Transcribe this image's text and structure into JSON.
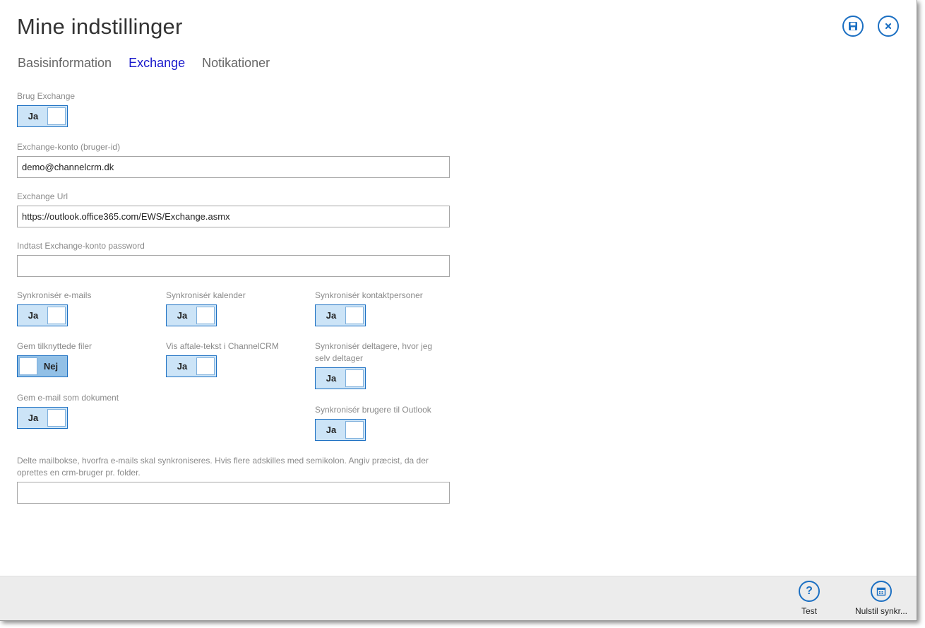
{
  "header": {
    "title": "Mine indstillinger",
    "save_icon": "save-icon",
    "close_icon": "close-icon"
  },
  "tabs": [
    {
      "label": "Basisinformation",
      "active": false
    },
    {
      "label": "Exchange",
      "active": true
    },
    {
      "label": "Notikationer",
      "active": false
    }
  ],
  "form": {
    "use_exchange": {
      "label": "Brug Exchange",
      "value": "Ja"
    },
    "account": {
      "label": "Exchange-konto (bruger-id)",
      "value": "demo@channelcrm.dk"
    },
    "url": {
      "label": "Exchange Url",
      "value": "https://outlook.office365.com/EWS/Exchange.asmx"
    },
    "password": {
      "label": "Indtast Exchange-konto password",
      "value": ""
    },
    "sync_emails": {
      "label": "Synkronisér e-mails",
      "value": "Ja"
    },
    "sync_calendar": {
      "label": "Synkronisér kalender",
      "value": "Ja"
    },
    "sync_contacts": {
      "label": "Synkronisér kontaktpersoner",
      "value": "Ja"
    },
    "save_attachments": {
      "label": "Gem tilknyttede filer",
      "value": "Nej"
    },
    "show_appointment_text": {
      "label": "Vis aftale-tekst i ChannelCRM",
      "value": "Ja"
    },
    "sync_participants": {
      "label_line1": "Synkronisér deltagere, hvor jeg",
      "label_line2": "selv deltager",
      "value": "Ja"
    },
    "save_email_doc": {
      "label": "Gem e-mail som dokument",
      "value": "Ja"
    },
    "sync_users_outlook": {
      "label": "Synkronisér brugere til Outlook",
      "value": "Ja"
    },
    "shared_mailboxes": {
      "label_line1": "Delte mailbokse, hvorfra e-mails skal synkroniseres. Hvis flere adskilles med semikolon. Angiv præcist, da der",
      "label_line2": "oprettes en crm-bruger pr. folder.",
      "value": ""
    }
  },
  "footer": {
    "test": {
      "label": "Test",
      "icon": "question-icon"
    },
    "reset": {
      "label": "Nulstil synkr...",
      "icon": "calendar-icon"
    }
  },
  "colors": {
    "accent": "#1b6fc2",
    "active_tab": "#1a1acc",
    "toggle_on": "#cce4f7",
    "toggle_off": "#92c0e6",
    "footer_bg": "#ececec"
  }
}
